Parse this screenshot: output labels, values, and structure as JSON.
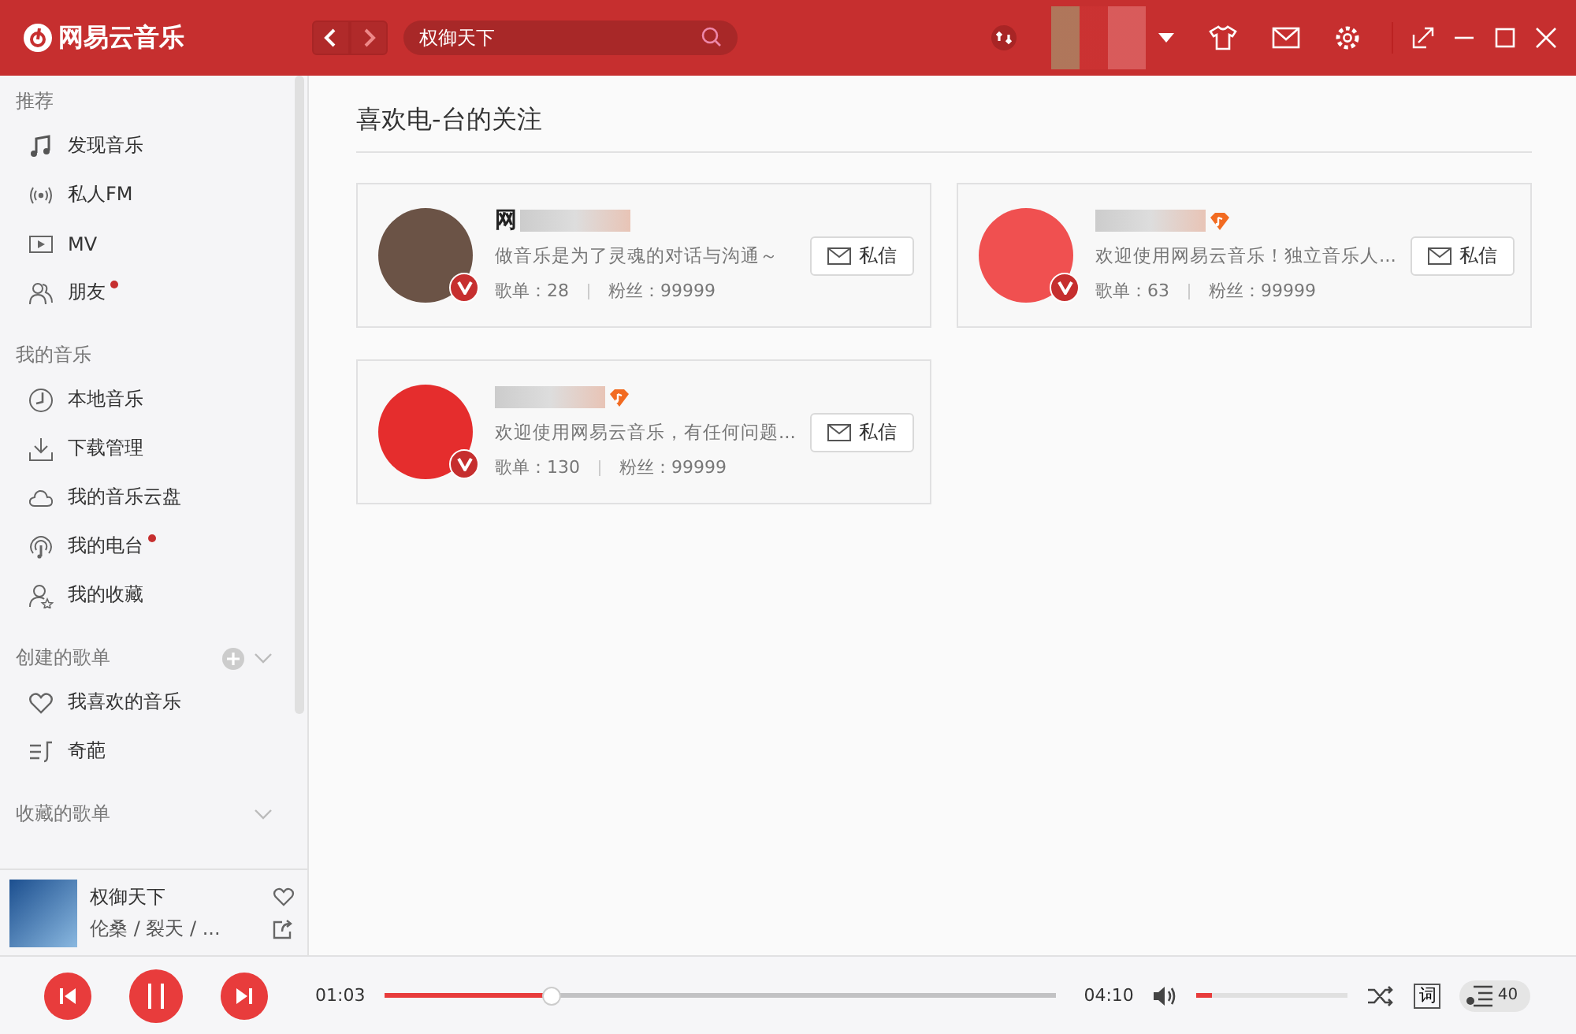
{
  "app": {
    "logo": "网易云音乐"
  },
  "search": {
    "value": "权御天下"
  },
  "sidebar": {
    "sections": [
      {
        "title": "推荐",
        "items": [
          {
            "label": "发现音乐",
            "unread": false
          },
          {
            "label": "私人FM",
            "unread": false
          },
          {
            "label": "MV",
            "unread": false
          },
          {
            "label": "朋友",
            "unread": true
          }
        ]
      },
      {
        "title": "我的音乐",
        "items": [
          {
            "label": "本地音乐",
            "unread": false
          },
          {
            "label": "下载管理",
            "unread": false
          },
          {
            "label": "我的音乐云盘",
            "unread": false
          },
          {
            "label": "我的电台",
            "unread": true
          },
          {
            "label": "我的收藏",
            "unread": false
          }
        ]
      },
      {
        "title": "创建的歌单",
        "items": [
          {
            "label": "我喜欢的音乐",
            "unread": false
          },
          {
            "label": "奇葩",
            "unread": false
          }
        ]
      },
      {
        "title": "收藏的歌单"
      }
    ]
  },
  "now_playing": {
    "title": "权御天下",
    "artists": "伦桑 / 裂天 / ..."
  },
  "page": {
    "title": "喜欢电-台的关注"
  },
  "follows": [
    {
      "name": "网",
      "bio": "做音乐是为了灵魂的对话与沟通～",
      "playlists": "歌单：28",
      "fans": "粉丝：99999",
      "button": "私信",
      "music_badge": false
    },
    {
      "bio": "欢迎使用网易云音乐！独立音乐人...",
      "playlists": "歌单：63",
      "fans": "粉丝：99999",
      "button": "私信",
      "music_badge": true
    },
    {
      "bio": "欢迎使用网易云音乐，有任何问题...",
      "playlists": "歌单：130",
      "fans": "粉丝：99999",
      "button": "私信",
      "music_badge": true
    }
  ],
  "player": {
    "elapsed": "01:03",
    "duration": "04:10",
    "level": 0.25,
    "volume": {
      "level": 0.1
    },
    "queue_count": "40",
    "lyrics": "词"
  }
}
